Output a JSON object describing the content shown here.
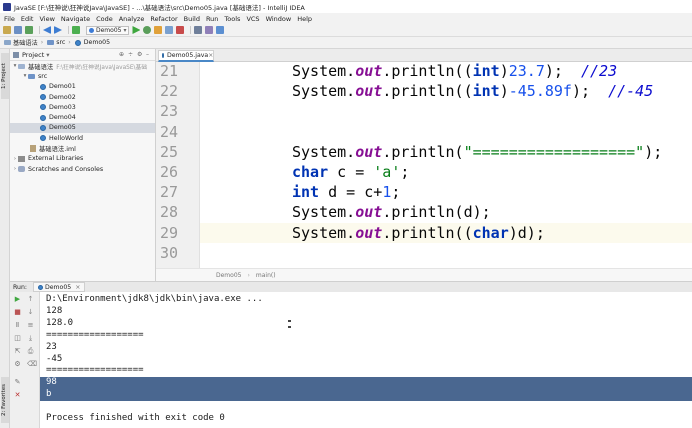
{
  "window": {
    "title": "JavaSE [F:\\狂神说\\狂神说Java\\JavaSE] - ...\\基础语法\\src\\Demo05.java [基础语法] - IntelliJ IDEA"
  },
  "menu": [
    "File",
    "Edit",
    "View",
    "Navigate",
    "Code",
    "Analyze",
    "Refactor",
    "Build",
    "Run",
    "Tools",
    "VCS",
    "Window",
    "Help"
  ],
  "toolbar": {
    "run_config": "Demo05"
  },
  "breadcrumb": [
    "基础语法",
    "src",
    "Demo05"
  ],
  "left_strip": {
    "project_tab": "1: Project",
    "favorites_tab": "2: Favorites"
  },
  "project_panel": {
    "title": "Project",
    "module": "基础语法",
    "module_path": "F:\\狂神说\\狂神说Java\\JavaSE\\基础",
    "src": "src",
    "classes": [
      "Demo01",
      "Demo02",
      "Demo03",
      "Demo04",
      "Demo05",
      "HelloWorld"
    ],
    "selected_class": "Demo05",
    "iml": "基础语法.iml",
    "external_libraries": "External Libraries",
    "scratches": "Scratches and Consoles"
  },
  "editor": {
    "tab_label": "Demo05.java",
    "line_numbers": [
      "21",
      "22",
      "23",
      "24",
      "25",
      "26",
      "27",
      "28",
      "29",
      "30"
    ],
    "current_line": "29",
    "breadcrumb": [
      "Demo05",
      "main()"
    ],
    "lines": [
      {
        "n": "21",
        "tokens": [
          {
            "t": "System.",
            "c": ""
          },
          {
            "t": "out",
            "c": "fld"
          },
          {
            "t": ".println((",
            "c": ""
          },
          {
            "t": "int",
            "c": "kw"
          },
          {
            "t": ")",
            "c": ""
          },
          {
            "t": "23.7",
            "c": "num"
          },
          {
            "t": ");  ",
            "c": ""
          },
          {
            "t": "//23",
            "c": "cmt"
          }
        ]
      },
      {
        "n": "22",
        "tokens": [
          {
            "t": "System.",
            "c": ""
          },
          {
            "t": "out",
            "c": "fld"
          },
          {
            "t": ".println((",
            "c": ""
          },
          {
            "t": "int",
            "c": "kw"
          },
          {
            "t": ")",
            "c": ""
          },
          {
            "t": "-45.89f",
            "c": "num"
          },
          {
            "t": ");  ",
            "c": ""
          },
          {
            "t": "//-45",
            "c": "cmt"
          }
        ]
      },
      {
        "n": "23",
        "tokens": []
      },
      {
        "n": "24",
        "tokens": []
      },
      {
        "n": "25",
        "tokens": [
          {
            "t": "System.",
            "c": ""
          },
          {
            "t": "out",
            "c": "fld"
          },
          {
            "t": ".println(",
            "c": ""
          },
          {
            "t": "\"==================\"",
            "c": "str"
          },
          {
            "t": ");",
            "c": ""
          }
        ]
      },
      {
        "n": "26",
        "tokens": [
          {
            "t": "char",
            "c": "kw"
          },
          {
            "t": " c = ",
            "c": ""
          },
          {
            "t": "'a'",
            "c": "str"
          },
          {
            "t": ";",
            "c": ""
          }
        ]
      },
      {
        "n": "27",
        "tokens": [
          {
            "t": "int",
            "c": "kw"
          },
          {
            "t": " d = c+",
            "c": ""
          },
          {
            "t": "1",
            "c": "num"
          },
          {
            "t": ";",
            "c": ""
          }
        ]
      },
      {
        "n": "28",
        "tokens": [
          {
            "t": "System.",
            "c": ""
          },
          {
            "t": "out",
            "c": "fld"
          },
          {
            "t": ".println(d);",
            "c": ""
          }
        ]
      },
      {
        "n": "29",
        "tokens": [
          {
            "t": "System.",
            "c": ""
          },
          {
            "t": "out",
            "c": "fld"
          },
          {
            "t": ".println((",
            "c": ""
          },
          {
            "t": "char",
            "c": "kw"
          },
          {
            "t": ")d);",
            "c": ""
          }
        ]
      },
      {
        "n": "30",
        "tokens": []
      }
    ]
  },
  "run_panel": {
    "label": "Run:",
    "tab": "Demo05",
    "console": [
      "D:\\Environment\\jdk8\\jdk\\bin\\java.exe ...",
      "128",
      "128.0",
      "==================",
      "23",
      "-45",
      "==================",
      "98",
      "b",
      "",
      "Process finished with exit code 0"
    ],
    "selected_lines": [
      "98",
      "b"
    ]
  },
  "colors": {
    "keyword": "#0033b3",
    "field": "#871094",
    "number": "#1750eb",
    "string": "#067d17",
    "comment": "#0c0ccf",
    "selection": "#4a6790"
  }
}
